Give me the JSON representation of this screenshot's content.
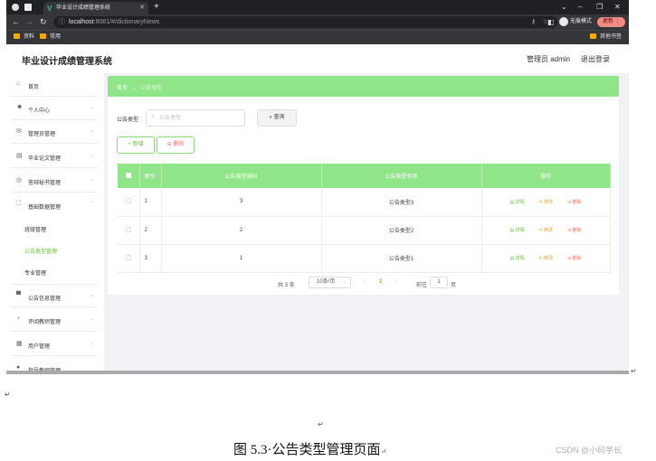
{
  "browser": {
    "tab_title": "毕业设计成绩管理系统",
    "new_tab": "+",
    "url_host": "localhost",
    "url_path": ":8081/#/dictionaryNews",
    "incognito": "无痕模式",
    "update": "更新",
    "bookmarks": [
      "资料",
      "常用"
    ],
    "other_bookmarks": "其他书签"
  },
  "header": {
    "title": "毕业设计成绩管理系统",
    "user": "管理员 admin",
    "logout": "退出登录"
  },
  "sidebar": {
    "items": [
      {
        "icon": "home-icon",
        "glyph": "⌂",
        "label": "首页",
        "chevron": ""
      },
      {
        "icon": "user-icon",
        "glyph": "☻",
        "label": "个人中心",
        "chevron": "⌄"
      },
      {
        "icon": "mail-icon",
        "glyph": "✉",
        "label": "管理员管理",
        "chevron": "⌄"
      },
      {
        "icon": "document-icon",
        "glyph": "▤",
        "label": "毕业论文管理",
        "chevron": "⌄"
      },
      {
        "icon": "globe-icon",
        "glyph": "◎",
        "label": "答辩秘书管理",
        "chevron": "⌄"
      },
      {
        "icon": "fullscreen-icon",
        "glyph": "⛶",
        "label": "基础数据管理",
        "chevron": "⌃"
      },
      {
        "icon": "monitor-icon",
        "glyph": "▀",
        "label": "公告信息管理",
        "chevron": "⌄"
      },
      {
        "icon": "mic-icon",
        "glyph": "♀",
        "label": "评阅教师管理",
        "chevron": "⌄"
      },
      {
        "icon": "building-icon",
        "glyph": "▦",
        "label": "用户管理",
        "chevron": "⌄"
      },
      {
        "icon": "pin-icon",
        "glyph": "●",
        "label": "指导教师管理",
        "chevron": ""
      }
    ],
    "subitems": [
      {
        "label": "班级管理",
        "active": false
      },
      {
        "label": "公告类型管理",
        "active": true
      },
      {
        "label": "专业管理",
        "active": false
      }
    ]
  },
  "breadcrumb": {
    "home": "首页",
    "sep": "→",
    "current": "公告类型"
  },
  "search": {
    "label": "公告类型",
    "placeholder": "公告类型",
    "value": "",
    "button": "查询"
  },
  "actions": {
    "add": "新增",
    "delete": "删除"
  },
  "table": {
    "headers": [
      "",
      "索引",
      "公告类型编码",
      "公告类型名称",
      "操作"
    ],
    "rows": [
      {
        "index": "1",
        "code": "3",
        "name": "公告类型3"
      },
      {
        "index": "2",
        "code": "2",
        "name": "公告类型2"
      },
      {
        "index": "3",
        "code": "1",
        "name": "公告类型1"
      }
    ],
    "ops": {
      "detail": "详情",
      "edit": "修改",
      "delete": "删除"
    }
  },
  "pagination": {
    "total": "共 3 条",
    "page_size": "10条/页",
    "prev": "‹",
    "current_page": "1",
    "next": "›",
    "goto_label": "前往",
    "goto_value": "1",
    "page_label": "页"
  },
  "doc": {
    "caption": "图 5.3·公告类型管理页面",
    "watermark": "CSDN @小码学长"
  },
  "colors": {
    "accent": "#8fe587",
    "green_text": "#67c23a",
    "warn": "#e6a23c",
    "danger": "#f56c6c"
  }
}
